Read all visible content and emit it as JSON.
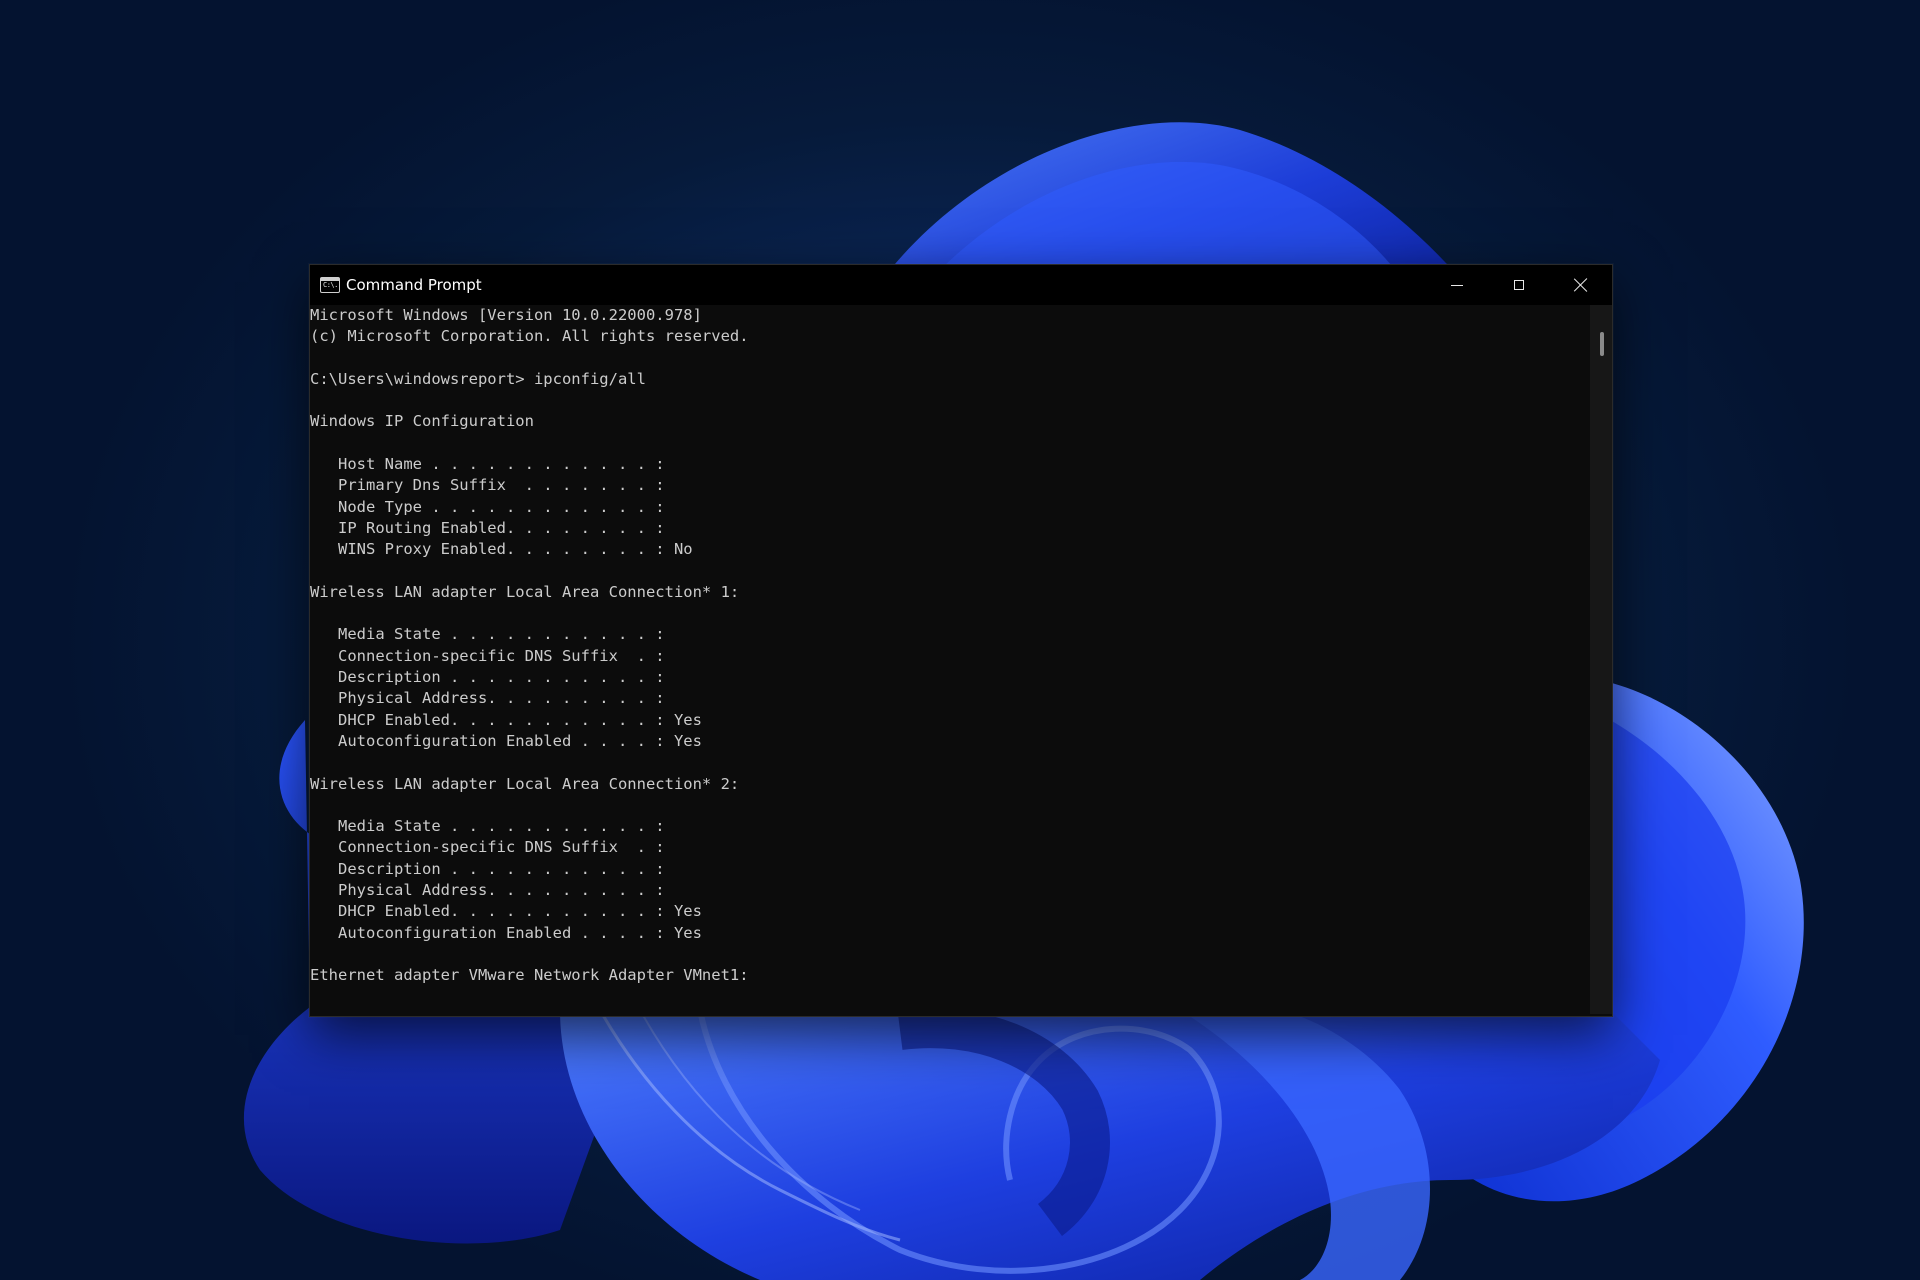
{
  "window": {
    "title": "Command Prompt",
    "icon": "cmd-icon",
    "icon_text": "C:\\.",
    "controls": {
      "minimize": "minimize-icon",
      "maximize": "maximize-icon",
      "close": "close-icon"
    }
  },
  "terminal": {
    "lines": [
      "Microsoft Windows [Version 10.0.22000.978]",
      "(c) Microsoft Corporation. All rights reserved.",
      "",
      "C:\\Users\\windowsreport> ipconfig/all",
      "",
      "Windows IP Configuration",
      "",
      "   Host Name . . . . . . . . . . . . :",
      "   Primary Dns Suffix  . . . . . . . :",
      "   Node Type . . . . . . . . . . . . :",
      "   IP Routing Enabled. . . . . . . . :",
      "   WINS Proxy Enabled. . . . . . . . : No",
      "",
      "Wireless LAN adapter Local Area Connection* 1:",
      "",
      "   Media State . . . . . . . . . . . :",
      "   Connection-specific DNS Suffix  . :",
      "   Description . . . . . . . . . . . :",
      "   Physical Address. . . . . . . . . :",
      "   DHCP Enabled. . . . . . . . . . . : Yes",
      "   Autoconfiguration Enabled . . . . : Yes",
      "",
      "Wireless LAN adapter Local Area Connection* 2:",
      "",
      "   Media State . . . . . . . . . . . :",
      "   Connection-specific DNS Suffix  . :",
      "   Description . . . . . . . . . . . :",
      "   Physical Address. . . . . . . . . :",
      "   DHCP Enabled. . . . . . . . . . . : Yes",
      "   Autoconfiguration Enabled . . . . : Yes",
      "",
      "Ethernet adapter VMware Network Adapter VMnet1:"
    ]
  },
  "colors": {
    "terminal_bg": "#0c0c0c",
    "terminal_text": "#cccccc",
    "titlebar_bg": "#000000",
    "wallpaper_accent": "#1f4fff"
  }
}
